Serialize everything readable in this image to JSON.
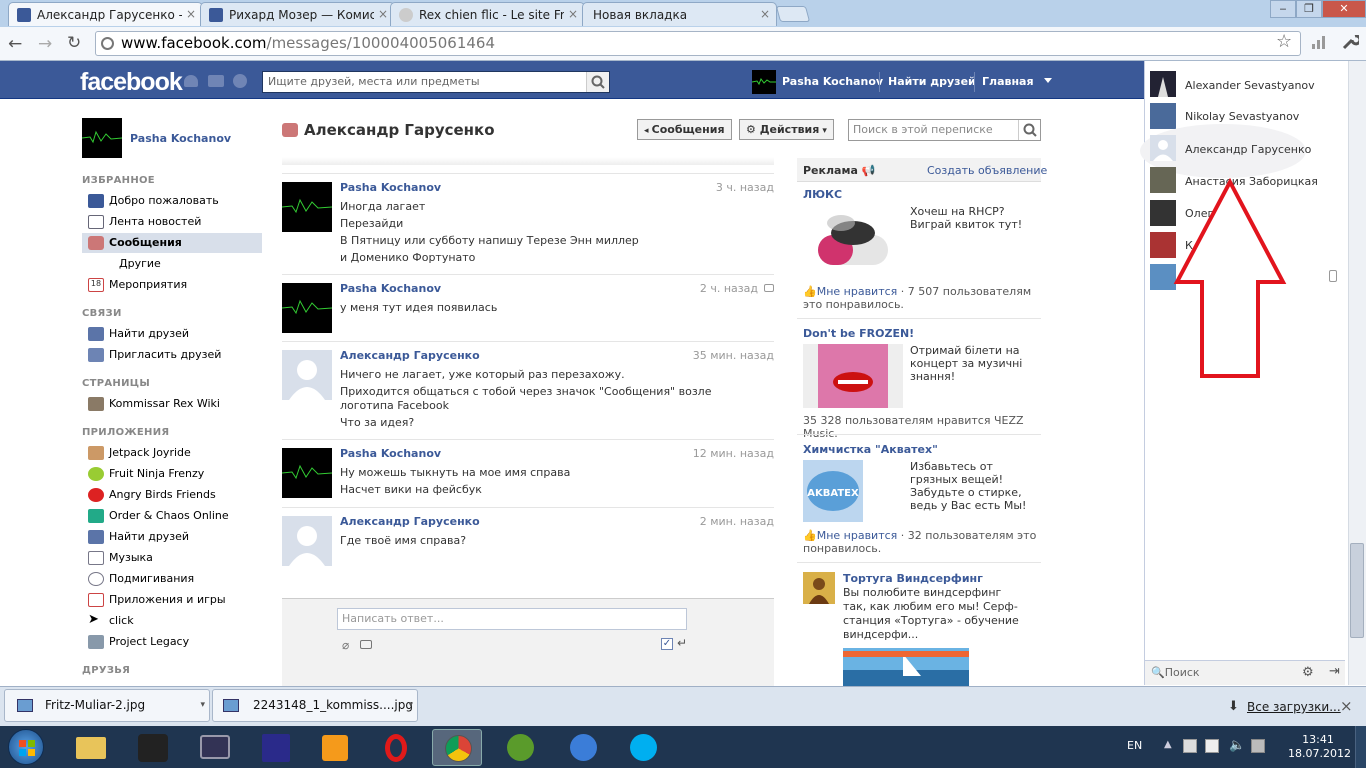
{
  "browser": {
    "tabs": [
      {
        "title": "Александр Гарусенко - Со",
        "favicon": "facebook-icon",
        "active": true
      },
      {
        "title": "Рихард Мозер — Комисса",
        "favicon": "facebook-icon",
        "active": false
      },
      {
        "title": "Rex chien flic - Le site Franç",
        "favicon": "globe-icon",
        "active": false
      },
      {
        "title": "Новая вкладка",
        "favicon": "",
        "active": false
      }
    ],
    "url_host": "www.facebook.com",
    "url_path": "/messages/100004005061464",
    "close_glyph": "×"
  },
  "fb": {
    "logo": "facebook",
    "search_placeholder": "Ищите друзей, места или предметы",
    "user": "Pasha Kochanov",
    "find_friends": "Найти друзей",
    "home": "Главная"
  },
  "sidebar": {
    "profile_name": "Pasha Kochanov",
    "sections": {
      "favorites": "ИЗБРАННОЕ",
      "connections": "СВЯЗИ",
      "pages": "СТРАНИЦЫ",
      "apps": "ПРИЛОЖЕНИЯ",
      "friends": "ДРУЗЬЯ"
    },
    "favorites": [
      "Добро пожаловать",
      "Лента новостей",
      "Сообщения",
      "Другие",
      "Мероприятия"
    ],
    "connections": [
      "Найти друзей",
      "Пригласить друзей"
    ],
    "pages": [
      "Kommissar Rex Wiki"
    ],
    "apps": [
      "Jetpack Joyride",
      "Fruit Ninja Frenzy",
      "Angry Birds Friends",
      "Order & Chaos Online",
      "Найти друзей",
      "Музыка",
      "Подмигивания",
      "Приложения и игры",
      "click",
      "Project Legacy"
    ],
    "events_day": "18"
  },
  "conversation": {
    "title": "Александр Гарусенко",
    "messages_button": "Сообщения",
    "actions_button": "Действия",
    "search_placeholder": "Поиск в этой переписке",
    "messages": [
      {
        "author": "Pasha Kochanov",
        "time": "3 ч. назад",
        "lines": [
          "Иногда лагает",
          "Перезайди",
          "В Пятницу или субботу напишу Терезе Энн миллер",
          "и Доменико Фортунато"
        ]
      },
      {
        "author": "Pasha Kochanov",
        "time": "2 ч. назад",
        "lines": [
          "у меня тут идея появилась"
        ]
      },
      {
        "author": "Александр Гарусенко",
        "time": "35 мин. назад",
        "lines": [
          "Ничего не лагает, уже который раз перезахожу.",
          "Приходится общаться с тобой через значок \"Сообщения\" возле",
          "логотипа Facebook",
          "Что за идея?"
        ]
      },
      {
        "author": "Pasha Kochanov",
        "time": "12 мин. назад",
        "lines": [
          "Ну можешь тыкнуть на мое имя справа",
          "Насчет вики на фейсбук"
        ]
      },
      {
        "author": "Александр Гарусенко",
        "time": "2 мин. назад",
        "lines": [
          "Где твоё имя справа?"
        ]
      }
    ],
    "reply_placeholder": "Написать ответ..."
  },
  "ads": {
    "header": "Реклама",
    "create": "Создать объявление",
    "items": [
      {
        "title": "ЛЮКС",
        "text": "Хочеш на RHCP? Виграй квиток тут!",
        "like": "Мне нравится",
        "social": " · 7 507 пользователям это понравилось."
      },
      {
        "title": "Don't be FROZEN!",
        "text": "Отримай білети на концерт за музичні знання!",
        "like": "",
        "social": "35 328 пользователям нравится ЧЕZZ Music."
      },
      {
        "title": "Химчистка \"Акватех\"",
        "text": "Избавьтесь от грязных вещей! Забудьте о стирке, ведь у Вас есть Мы!",
        "like": "Мне нравится",
        "social": " · 32 пользователям это понравилось."
      },
      {
        "title": "Тортуга Виндсерфинг",
        "text": "Вы полюбите виндсерфинг так, как любим его мы! Серф-станция «Тортуга» - обучение виндсерфи..."
      }
    ]
  },
  "chat": {
    "friends": [
      "Alexander Sevastyanov",
      "Nikolay Sevastyanov",
      "Александр Гарусенко",
      "Анастасия Заборицкая",
      "Олег",
      "К"
    ],
    "search": "Поиск"
  },
  "downloads": {
    "items": [
      "Fritz-Muliar-2.jpg",
      "2243148_1_kommiss....jpg"
    ],
    "all": "Все загрузки...",
    "close": "×"
  },
  "taskbar": {
    "lang": "EN",
    "time": "13:41",
    "date": "18.07.2012"
  }
}
